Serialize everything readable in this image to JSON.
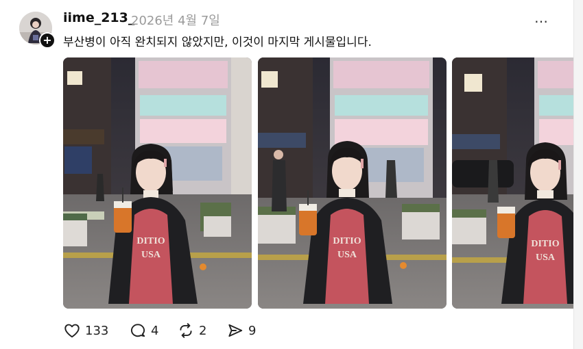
{
  "post": {
    "username": "iime_213_",
    "date": "2026년 4월 7일",
    "caption": "부산병이 아직 완치되지 않았지만, 이것이 마지막 게시물입니다.",
    "more_icon": "…"
  },
  "actions": {
    "likes": "133",
    "comments": "4",
    "reposts": "2",
    "shares": "9"
  },
  "colors": {
    "text": "#111111",
    "muted": "#9a9a9a",
    "background": "#ffffff",
    "sweater": "#c4545e",
    "jacket": "#1f1f22",
    "drink": "#d8762a"
  }
}
